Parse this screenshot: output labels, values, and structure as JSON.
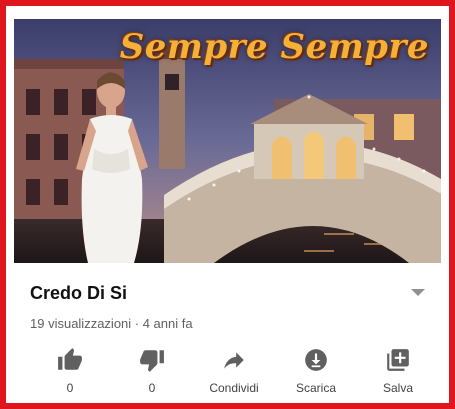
{
  "video": {
    "overlay_title": "Sempre Sempre",
    "title": "Credo Di Si",
    "meta": "19 visualizzazioni · 4 anni fa"
  },
  "actions": [
    {
      "icon": "thumbs-up-icon",
      "label": "0"
    },
    {
      "icon": "thumbs-down-icon",
      "label": "0"
    },
    {
      "icon": "share-icon",
      "label": "Condividi"
    },
    {
      "icon": "download-icon",
      "label": "Scarica"
    },
    {
      "icon": "save-playlist-icon",
      "label": "Salva"
    }
  ],
  "colors": {
    "frame": "#e0161e",
    "icon": "#606060",
    "overlay_title": "#f3b13a"
  }
}
